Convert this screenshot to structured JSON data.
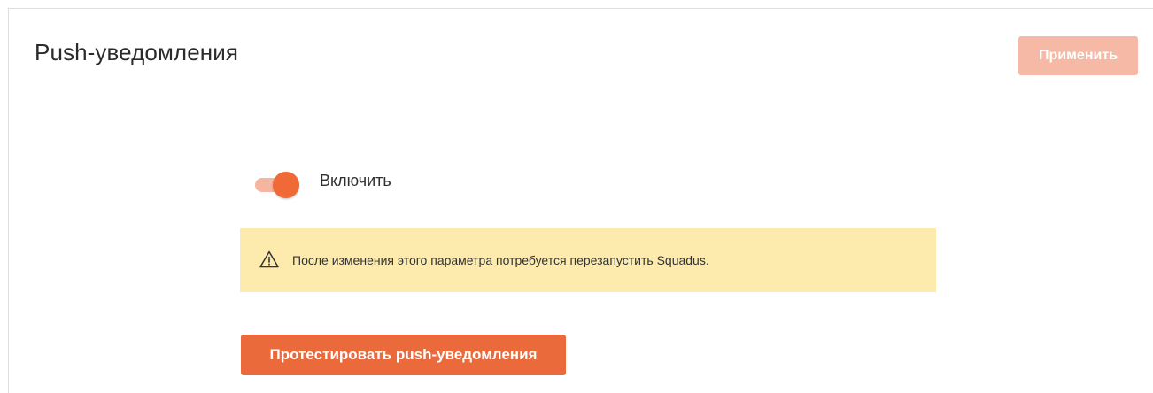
{
  "header": {
    "title": "Push-уведомления",
    "apply_label": "Применить"
  },
  "toggle": {
    "label": "Включить",
    "state": "on",
    "accent_color": "#ef6a37"
  },
  "warning": {
    "icon": "warning-triangle-icon",
    "text": "После изменения этого параметра потребуется перезапустить Squadus.",
    "background": "#fcebac"
  },
  "actions": {
    "test_label": "Протестировать push-уведомления"
  },
  "colors": {
    "primary": "#ea6a3b",
    "primary_disabled": "#f5b9a5"
  }
}
